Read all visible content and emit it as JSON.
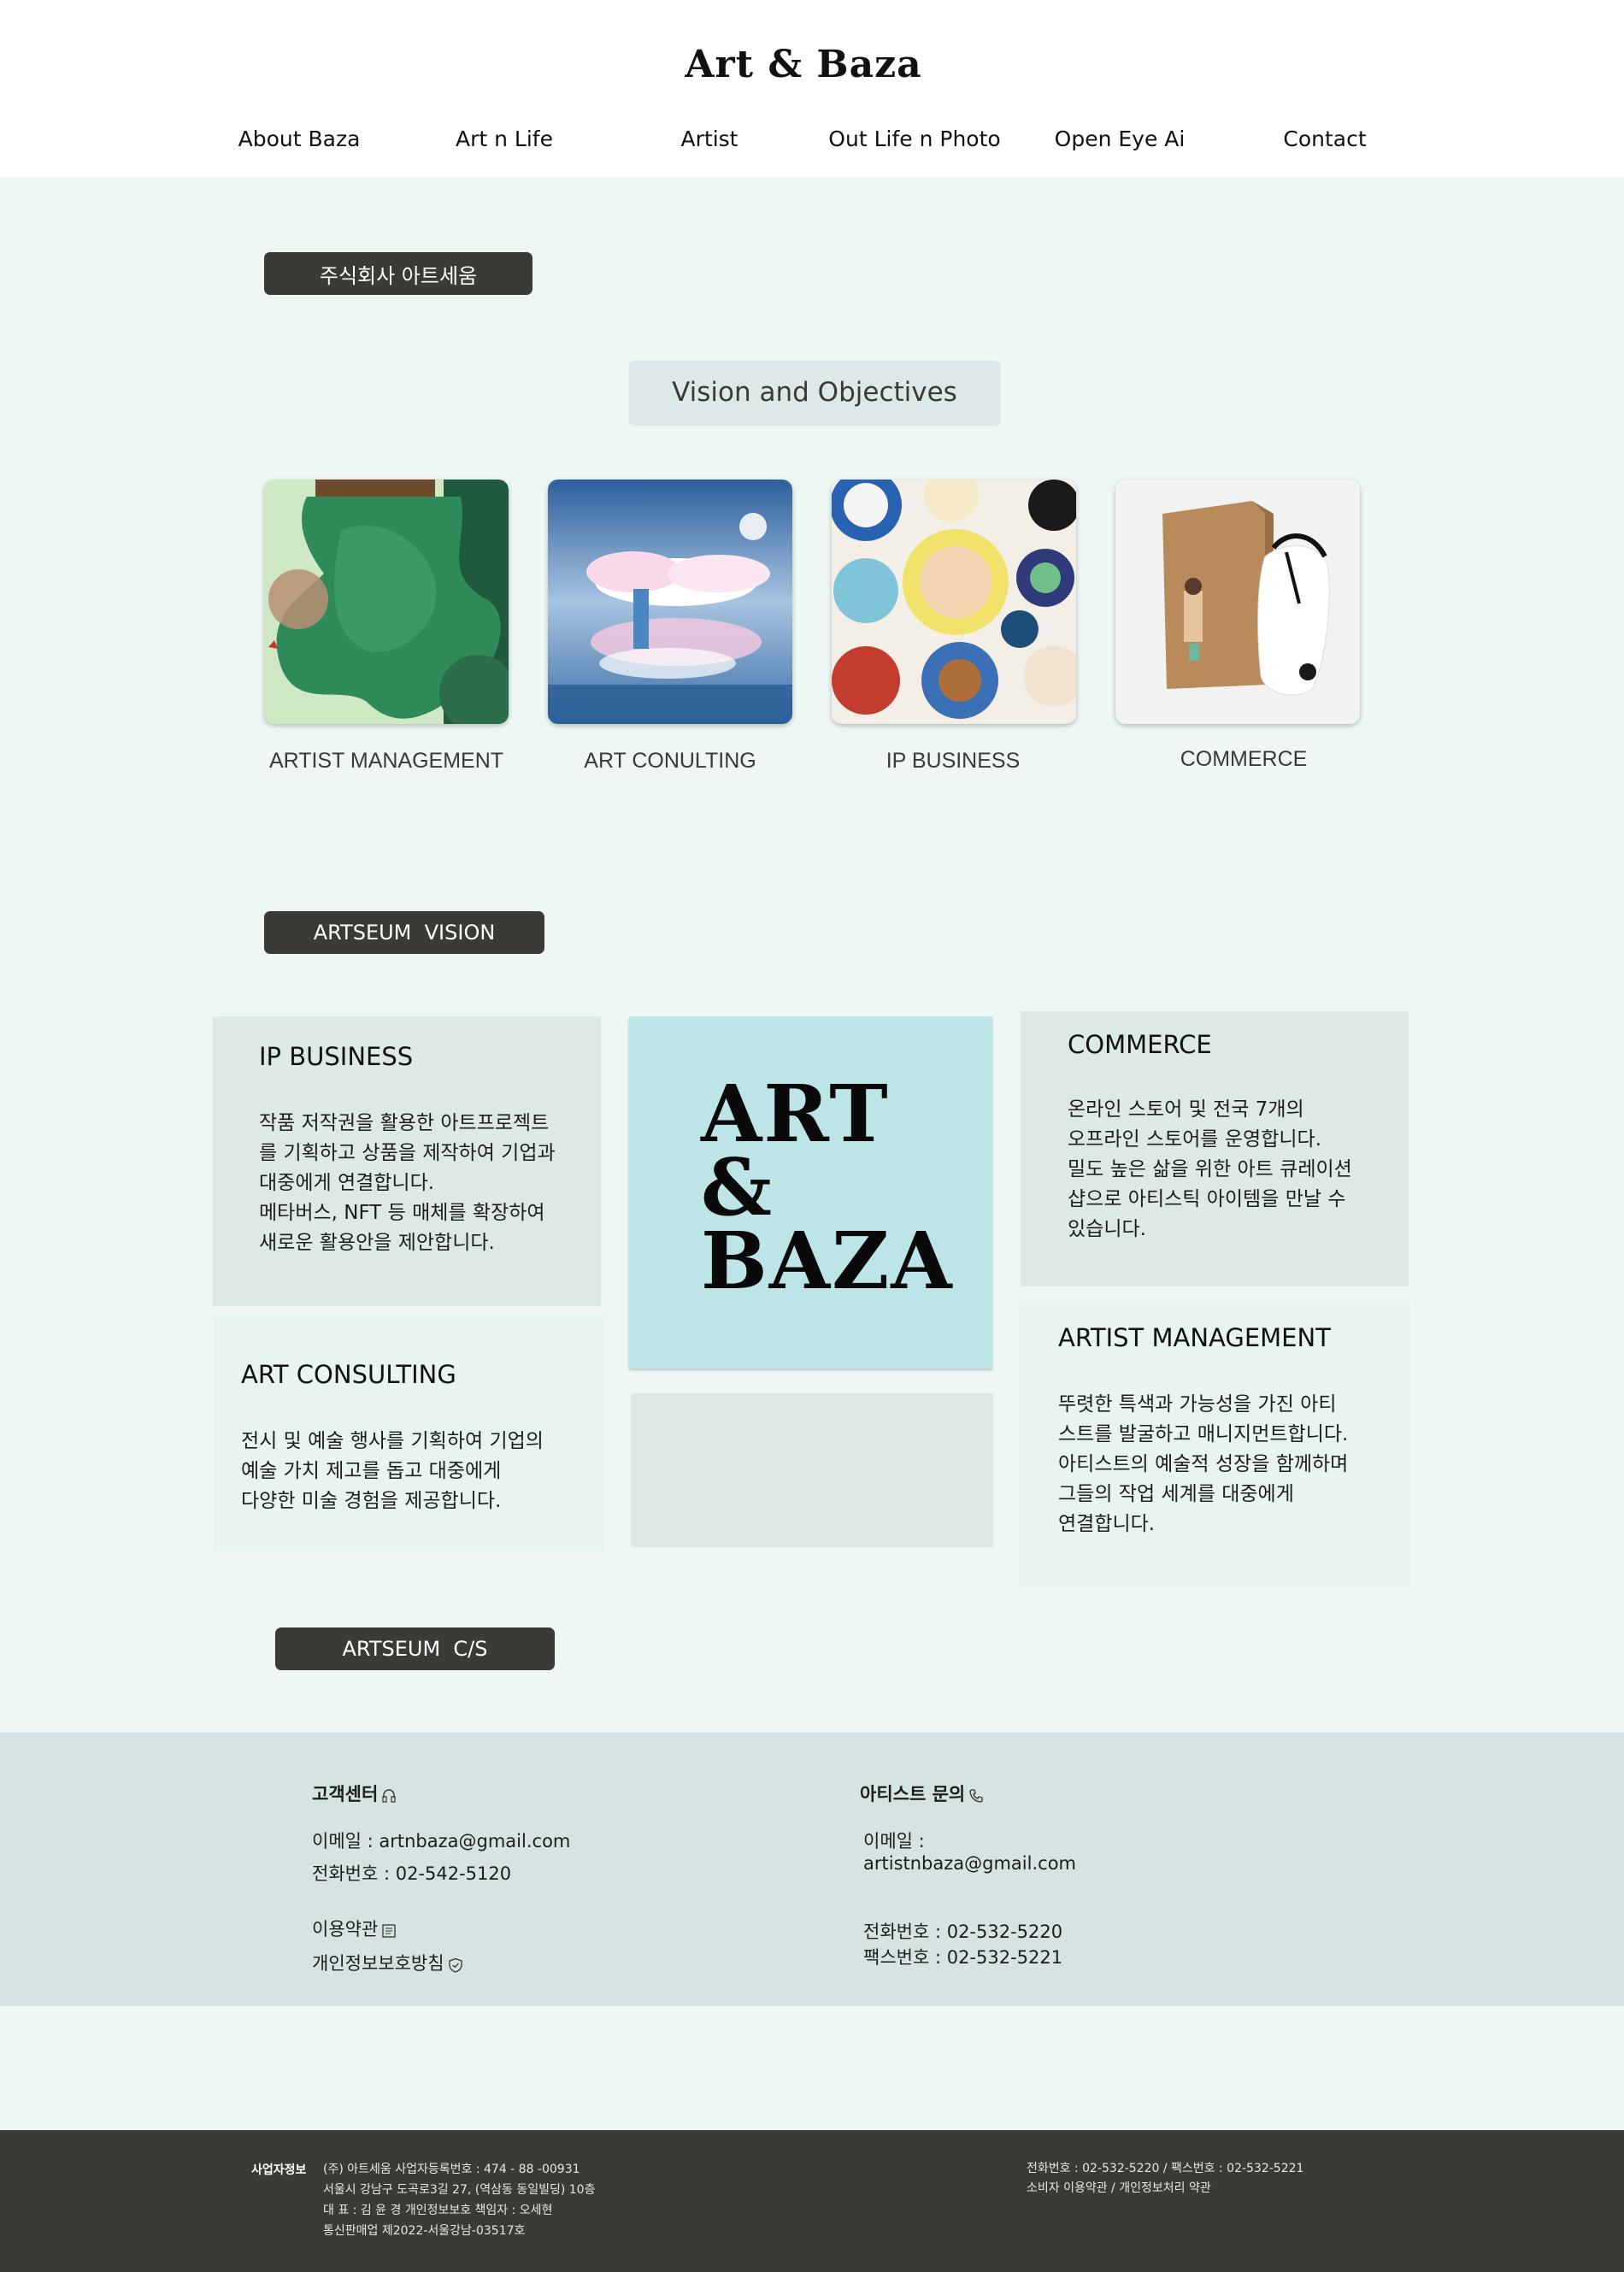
{
  "header": {
    "brand": "Art & Baza",
    "nav": [
      "About Baza",
      "Art n Life",
      "Artist",
      "Out Life n Photo",
      "Open Eye Ai",
      "Contact"
    ]
  },
  "company_badge": "주식회사 아트세움",
  "vision_title": "Vision and Objectives",
  "cards": [
    {
      "label": "ARTIST MANAGEMENT",
      "image": "green abstract artwork"
    },
    {
      "label": "ART CONULTING",
      "image": "clouds reflection artwork"
    },
    {
      "label": "IP BUSINESS",
      "image": "decorative plates"
    },
    {
      "label": "COMMERCE",
      "image": "product package"
    }
  ],
  "vision_badge": "ARTSEUM  VISION",
  "boxes": {
    "ip_business": {
      "title": "IP BUSINESS",
      "text": "작품 저작권을 활용한 아트프로젝트\n를 기획하고 상품을 제작하여 기업과\n대중에게 연결합니다.\n메타버스, NFT 등 매체를 확장하여\n새로운 활용안을 제안합니다."
    },
    "commerce": {
      "title": "COMMERCE",
      "text": "온라인 스토어 및 전국 7개의\n오프라인 스토어를 운영합니다.\n밀도 높은 삶을 위한 아트 큐레이션\n샵으로 아티스틱 아이템을 만날 수\n있습니다."
    },
    "art_consulting": {
      "title": "ART CONSULTING",
      "text": "전시 및 예술 행사를 기획하여 기업의\n예술 가치 제고를 돕고 대중에게\n다양한 미술 경험을 제공합니다."
    },
    "artist_management": {
      "title": "ARTIST MANAGEMENT",
      "text": "뚜렷한 특색과 가능성을 가진 아티\n스트를 발굴하고 매니지먼트합니다.\n아티스트의 예술적 성장을 함께하며\n그들의 작업 세계를 대중에게\n연결합니다."
    },
    "center_logo": "ART\n&\nBAZA"
  },
  "cs_badge": "ARTSEUM  C/S",
  "customer_center": {
    "title": "고객센터",
    "email": "이메일 : artnbaza@gmail.com",
    "phone": "전화번호 : 02-542-5120",
    "terms": "이용약관",
    "privacy": "개인정보보호방침"
  },
  "artist_inquiry": {
    "title": "아티스트 문의",
    "email_label": "이메일 :",
    "email": "artistnbaza@gmail.com",
    "phone": "전화번호 : 02-532-5220",
    "fax": "팩스번호 : 02-532-5221"
  },
  "business_info": {
    "label": "사업자정보",
    "line1": "(주) 아트세움      사업자등록번호 : 474 - 88 -00931",
    "line2": "서울시 강남구 도곡로3길 27, (역삼동 동일빌딩) 10층",
    "line3": "대 표 : 김 윤 경     개인정보보호 책임자 :  오세현",
    "line4": "통신판매업 제2022-서울강남-03517호",
    "right1": "전화번호 : 02-532-5220   /   팩스번호 : 02-532-5221",
    "right2": "소비자 이용약관   /   개인정보처리 약관"
  },
  "colors": {
    "page_bg": "#eef7f4",
    "dark_pill": "#3b3b36",
    "center_box": "#bde4e6",
    "footer_info_bg": "#d5e3e2",
    "bottom_footer_bg": "#3b3b36"
  }
}
